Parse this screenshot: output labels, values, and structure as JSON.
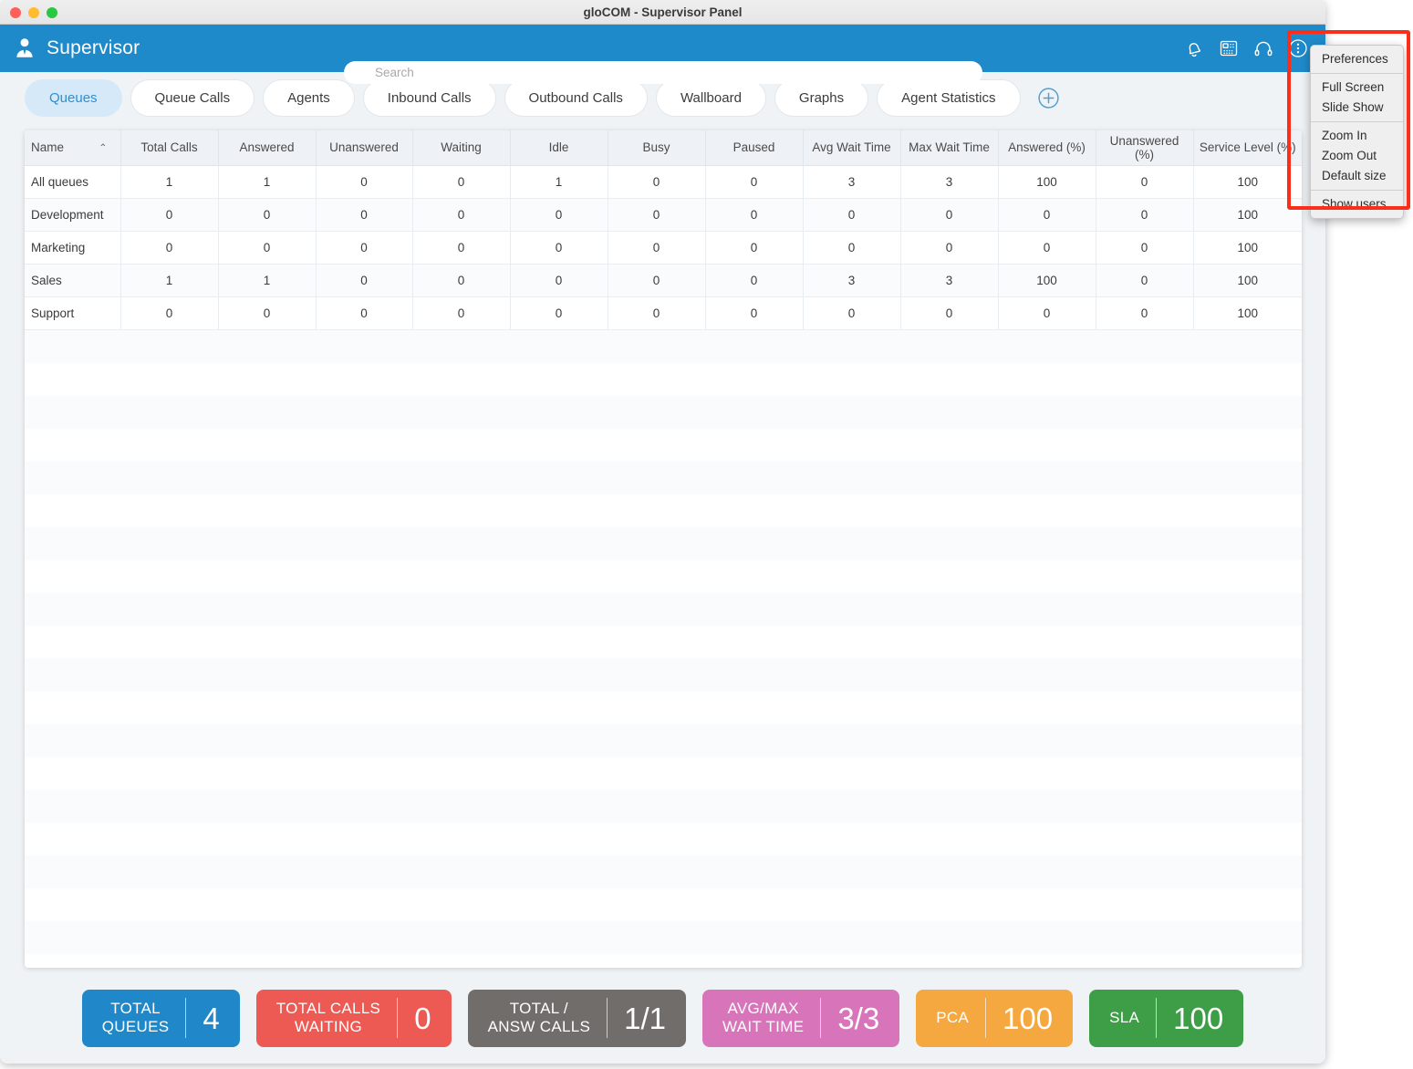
{
  "window": {
    "title": "gloCOM - Supervisor Panel",
    "traffic_lights": [
      "close",
      "minimize",
      "maximize"
    ]
  },
  "header": {
    "avatar_icon": "supervisor-avatar-icon",
    "title": "Supervisor",
    "search": {
      "placeholder": "Search",
      "value": "",
      "icon": "search-icon"
    },
    "icons": [
      {
        "name": "bell-icon",
        "label": "Notifications"
      },
      {
        "name": "desk-phone-icon",
        "label": "Phone"
      },
      {
        "name": "headset-icon",
        "label": "Headset"
      },
      {
        "name": "more-options-icon",
        "label": "More options"
      }
    ],
    "accent_color": "#1f8ac9"
  },
  "tabs": {
    "items": [
      {
        "label": "Queues",
        "active": true
      },
      {
        "label": "Queue Calls",
        "active": false
      },
      {
        "label": "Agents",
        "active": false
      },
      {
        "label": "Inbound Calls",
        "active": false
      },
      {
        "label": "Outbound Calls",
        "active": false
      },
      {
        "label": "Wallboard",
        "active": false
      },
      {
        "label": "Graphs",
        "active": false
      },
      {
        "label": "Agent Statistics",
        "active": false
      }
    ],
    "add_tab_icon": "plus-circle-icon",
    "active_bg": "#d6e9f9",
    "active_text": "#2b8fd6"
  },
  "table": {
    "sort_column": "Name",
    "sort_direction": "ascending",
    "sort_caret": "⌃",
    "columns": [
      "Name",
      "Total Calls",
      "Answered",
      "Unanswered",
      "Waiting",
      "Idle",
      "Busy",
      "Paused",
      "Avg Wait Time",
      "Max Wait Time",
      "Answered (%)",
      "Unanswered (%)",
      "Service Level (%)"
    ],
    "rows": [
      {
        "cells": [
          "All queues",
          "1",
          "1",
          "0",
          "0",
          "1",
          "0",
          "0",
          "3",
          "3",
          "100",
          "0",
          "100"
        ]
      },
      {
        "cells": [
          "Development",
          "0",
          "0",
          "0",
          "0",
          "0",
          "0",
          "0",
          "0",
          "0",
          "0",
          "0",
          "100"
        ]
      },
      {
        "cells": [
          "Marketing",
          "0",
          "0",
          "0",
          "0",
          "0",
          "0",
          "0",
          "0",
          "0",
          "0",
          "0",
          "100"
        ]
      },
      {
        "cells": [
          "Sales",
          "1",
          "1",
          "0",
          "0",
          "0",
          "0",
          "0",
          "3",
          "3",
          "100",
          "0",
          "100"
        ]
      },
      {
        "cells": [
          "Support",
          "0",
          "0",
          "0",
          "0",
          "0",
          "0",
          "0",
          "0",
          "0",
          "0",
          "0",
          "100"
        ]
      }
    ]
  },
  "status_metrics": [
    {
      "label": "TOTAL\nQUEUES",
      "value": "4",
      "color": "#2088c8"
    },
    {
      "label": "TOTAL CALLS\nWAITING",
      "value": "0",
      "color": "#ec5a53"
    },
    {
      "label": "TOTAL /\nANSW CALLS",
      "value": "1/1",
      "color": "#716d6a"
    },
    {
      "label": "AVG/MAX\nWAIT TIME",
      "value": "3/3",
      "color": "#d874ba"
    },
    {
      "label": "PCA",
      "value": "100",
      "color": "#f5a83f"
    },
    {
      "label": "SLA",
      "value": "100",
      "color": "#3d9e47"
    }
  ],
  "context_menu": {
    "groups": [
      {
        "items": [
          "Preferences"
        ]
      },
      {
        "items": [
          "Full Screen",
          "Slide Show"
        ]
      },
      {
        "items": [
          "Zoom In",
          "Zoom Out",
          "Default size"
        ]
      },
      {
        "items": [
          "Show users"
        ]
      }
    ]
  },
  "annotation": {
    "type": "rectangle-highlight",
    "color": "#fb2e1a"
  }
}
